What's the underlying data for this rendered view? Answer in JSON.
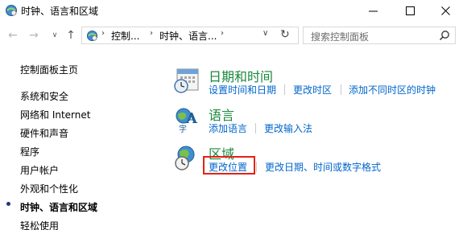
{
  "window": {
    "title": "时钟、语言和区域",
    "minimize_glyph": "—",
    "maximize_glyph": "☐",
    "close_glyph": "✕"
  },
  "nav": {
    "back_glyph": "←",
    "forward_glyph": "→",
    "recent_glyph": "∨",
    "up_glyph": "↑",
    "breadcrumb": [
      "控制...",
      "时钟、语言..."
    ],
    "dropdown_glyph": "∨",
    "refresh_glyph": "↻",
    "search_placeholder": "搜索控制面板"
  },
  "sidebar": {
    "items": [
      {
        "label": "控制面板主页"
      },
      {
        "label": "系统和安全"
      },
      {
        "label": "网络和 Internet"
      },
      {
        "label": "硬件和声音"
      },
      {
        "label": "程序"
      },
      {
        "label": "用户帐户"
      },
      {
        "label": "外观和个性化"
      },
      {
        "label": "时钟、语言和区域",
        "active": true
      },
      {
        "label": "轻松使用"
      }
    ]
  },
  "categories": {
    "datetime": {
      "title": "日期和时间",
      "links": [
        "设置时间和日期",
        "更改时区",
        "添加不同时区的时钟"
      ]
    },
    "language": {
      "title": "语言",
      "links": [
        "添加语言",
        "更改输入法"
      ]
    },
    "region": {
      "title": "区域",
      "links": [
        "更改位置",
        "更改日期、时间或数字格式"
      ]
    }
  },
  "colors": {
    "category_title": "#19883b",
    "link": "#0066cc",
    "highlight_box": "#e32219"
  }
}
